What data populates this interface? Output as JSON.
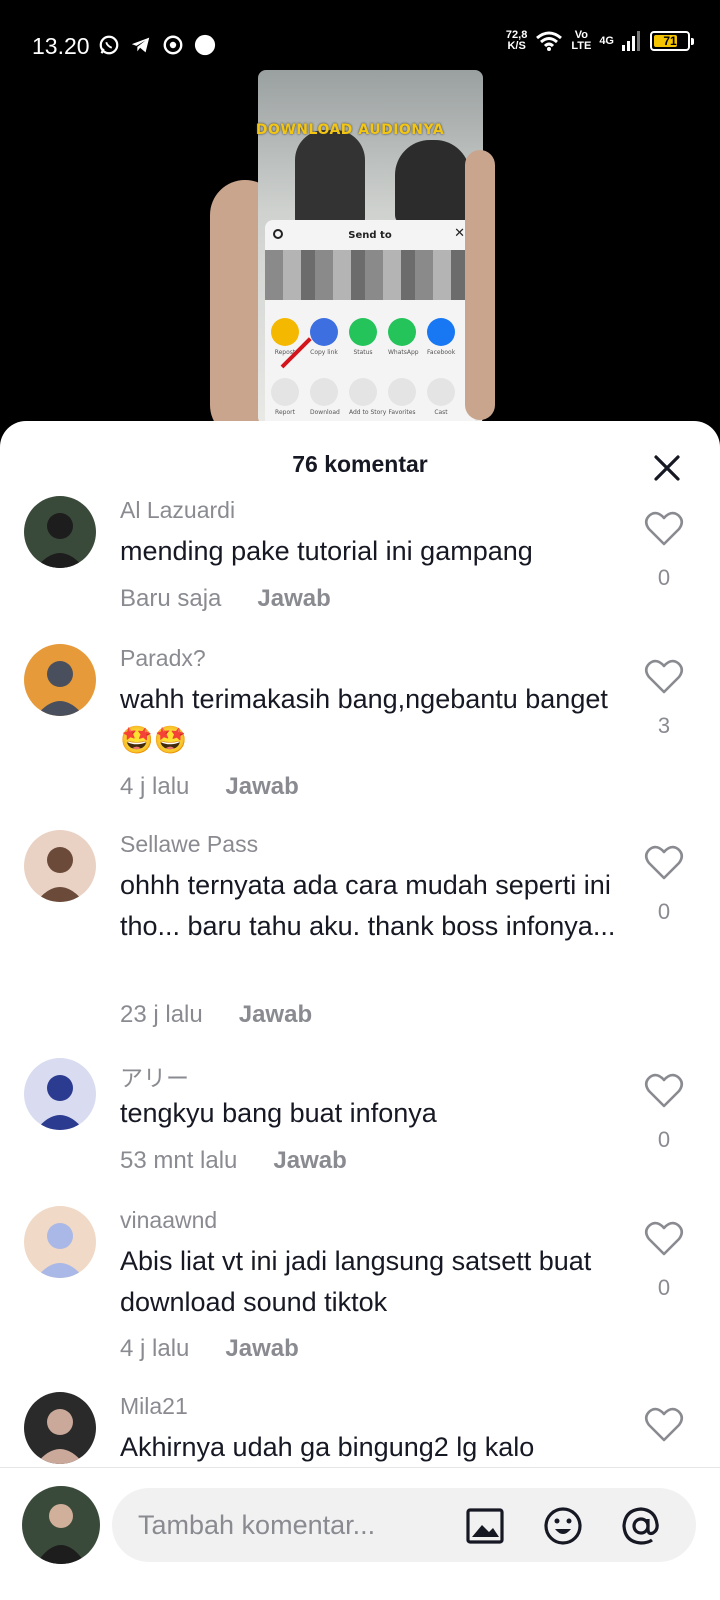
{
  "status_bar": {
    "time": "13.20",
    "speed_value": "72,8",
    "speed_unit": "K/S",
    "volte_top": "Vo",
    "volte_bottom": "LTE",
    "network": "4G",
    "battery": "71",
    "battery_level": 0.71,
    "left_icons": [
      "whatsapp-icon",
      "telegram-icon",
      "chrome-icon",
      "dot-icon"
    ],
    "right_icons": [
      "wifi-icon",
      "signal-icon",
      "battery-icon"
    ]
  },
  "video": {
    "overlay_text": "DOWNLOAD AUDIONYA",
    "share_title": "Send to",
    "share_apps": [
      {
        "label": "Repost",
        "color": "#f5b800"
      },
      {
        "label": "Copy link",
        "color": "#3d6fe0"
      },
      {
        "label": "Status",
        "color": "#25c45b"
      },
      {
        "label": "WhatsApp",
        "color": "#25c45b"
      },
      {
        "label": "Facebook",
        "color": "#1877f2"
      }
    ],
    "share_actions": [
      "Report",
      "Download",
      "Add to Story",
      "Favorites",
      "Cast"
    ]
  },
  "comments_sheet": {
    "title": "76 komentar",
    "close_icon": "close-icon"
  },
  "comments": [
    {
      "user": "Al Lazuardi",
      "text": "mending pake tutorial ini gampang",
      "time": "Baru saja",
      "reply": "Jawab",
      "likes": "0",
      "avatar_colors": [
        "#3a4a3a",
        "#1d1d1d"
      ]
    },
    {
      "user": "Paradx?",
      "text": "wahh terimakasih bang,ngebantu banget🤩🤩",
      "time": "4 j lalu",
      "reply": "Jawab",
      "likes": "3",
      "avatar_colors": [
        "#e79a3a",
        "#4a4f5e"
      ]
    },
    {
      "user": "Sellawe Pass",
      "text": "ohhh ternyata ada cara mudah seperti ini tho... baru tahu aku. thank boss infonya...",
      "time": "23 j lalu",
      "reply": "Jawab",
      "likes": "0",
      "avatar_colors": [
        "#e9d2c4",
        "#6b4a3a"
      ]
    },
    {
      "user": "アリー",
      "text": "tengkyu bang buat infonya",
      "time": "53 mnt lalu",
      "reply": "Jawab",
      "likes": "0",
      "avatar_colors": [
        "#d9dcf0",
        "#2b3b8f"
      ]
    },
    {
      "user": "vinaawnd",
      "text": "Abis liat vt ini jadi langsung satsett buat download sound tiktok",
      "time": "4 j lalu",
      "reply": "Jawab",
      "likes": "0",
      "avatar_colors": [
        "#f0d9c6",
        "#a9b8e6"
      ]
    },
    {
      "user": "Mila21",
      "text": "Akhirnya udah ga bingung2 lg kalo",
      "time": "",
      "reply": "",
      "likes": "",
      "avatar_colors": [
        "#2a2a2a",
        "#caa89a"
      ]
    }
  ],
  "input_bar": {
    "placeholder": "Tambah komentar...",
    "icons": [
      "image-icon",
      "emoji-icon",
      "mention-icon"
    ]
  }
}
